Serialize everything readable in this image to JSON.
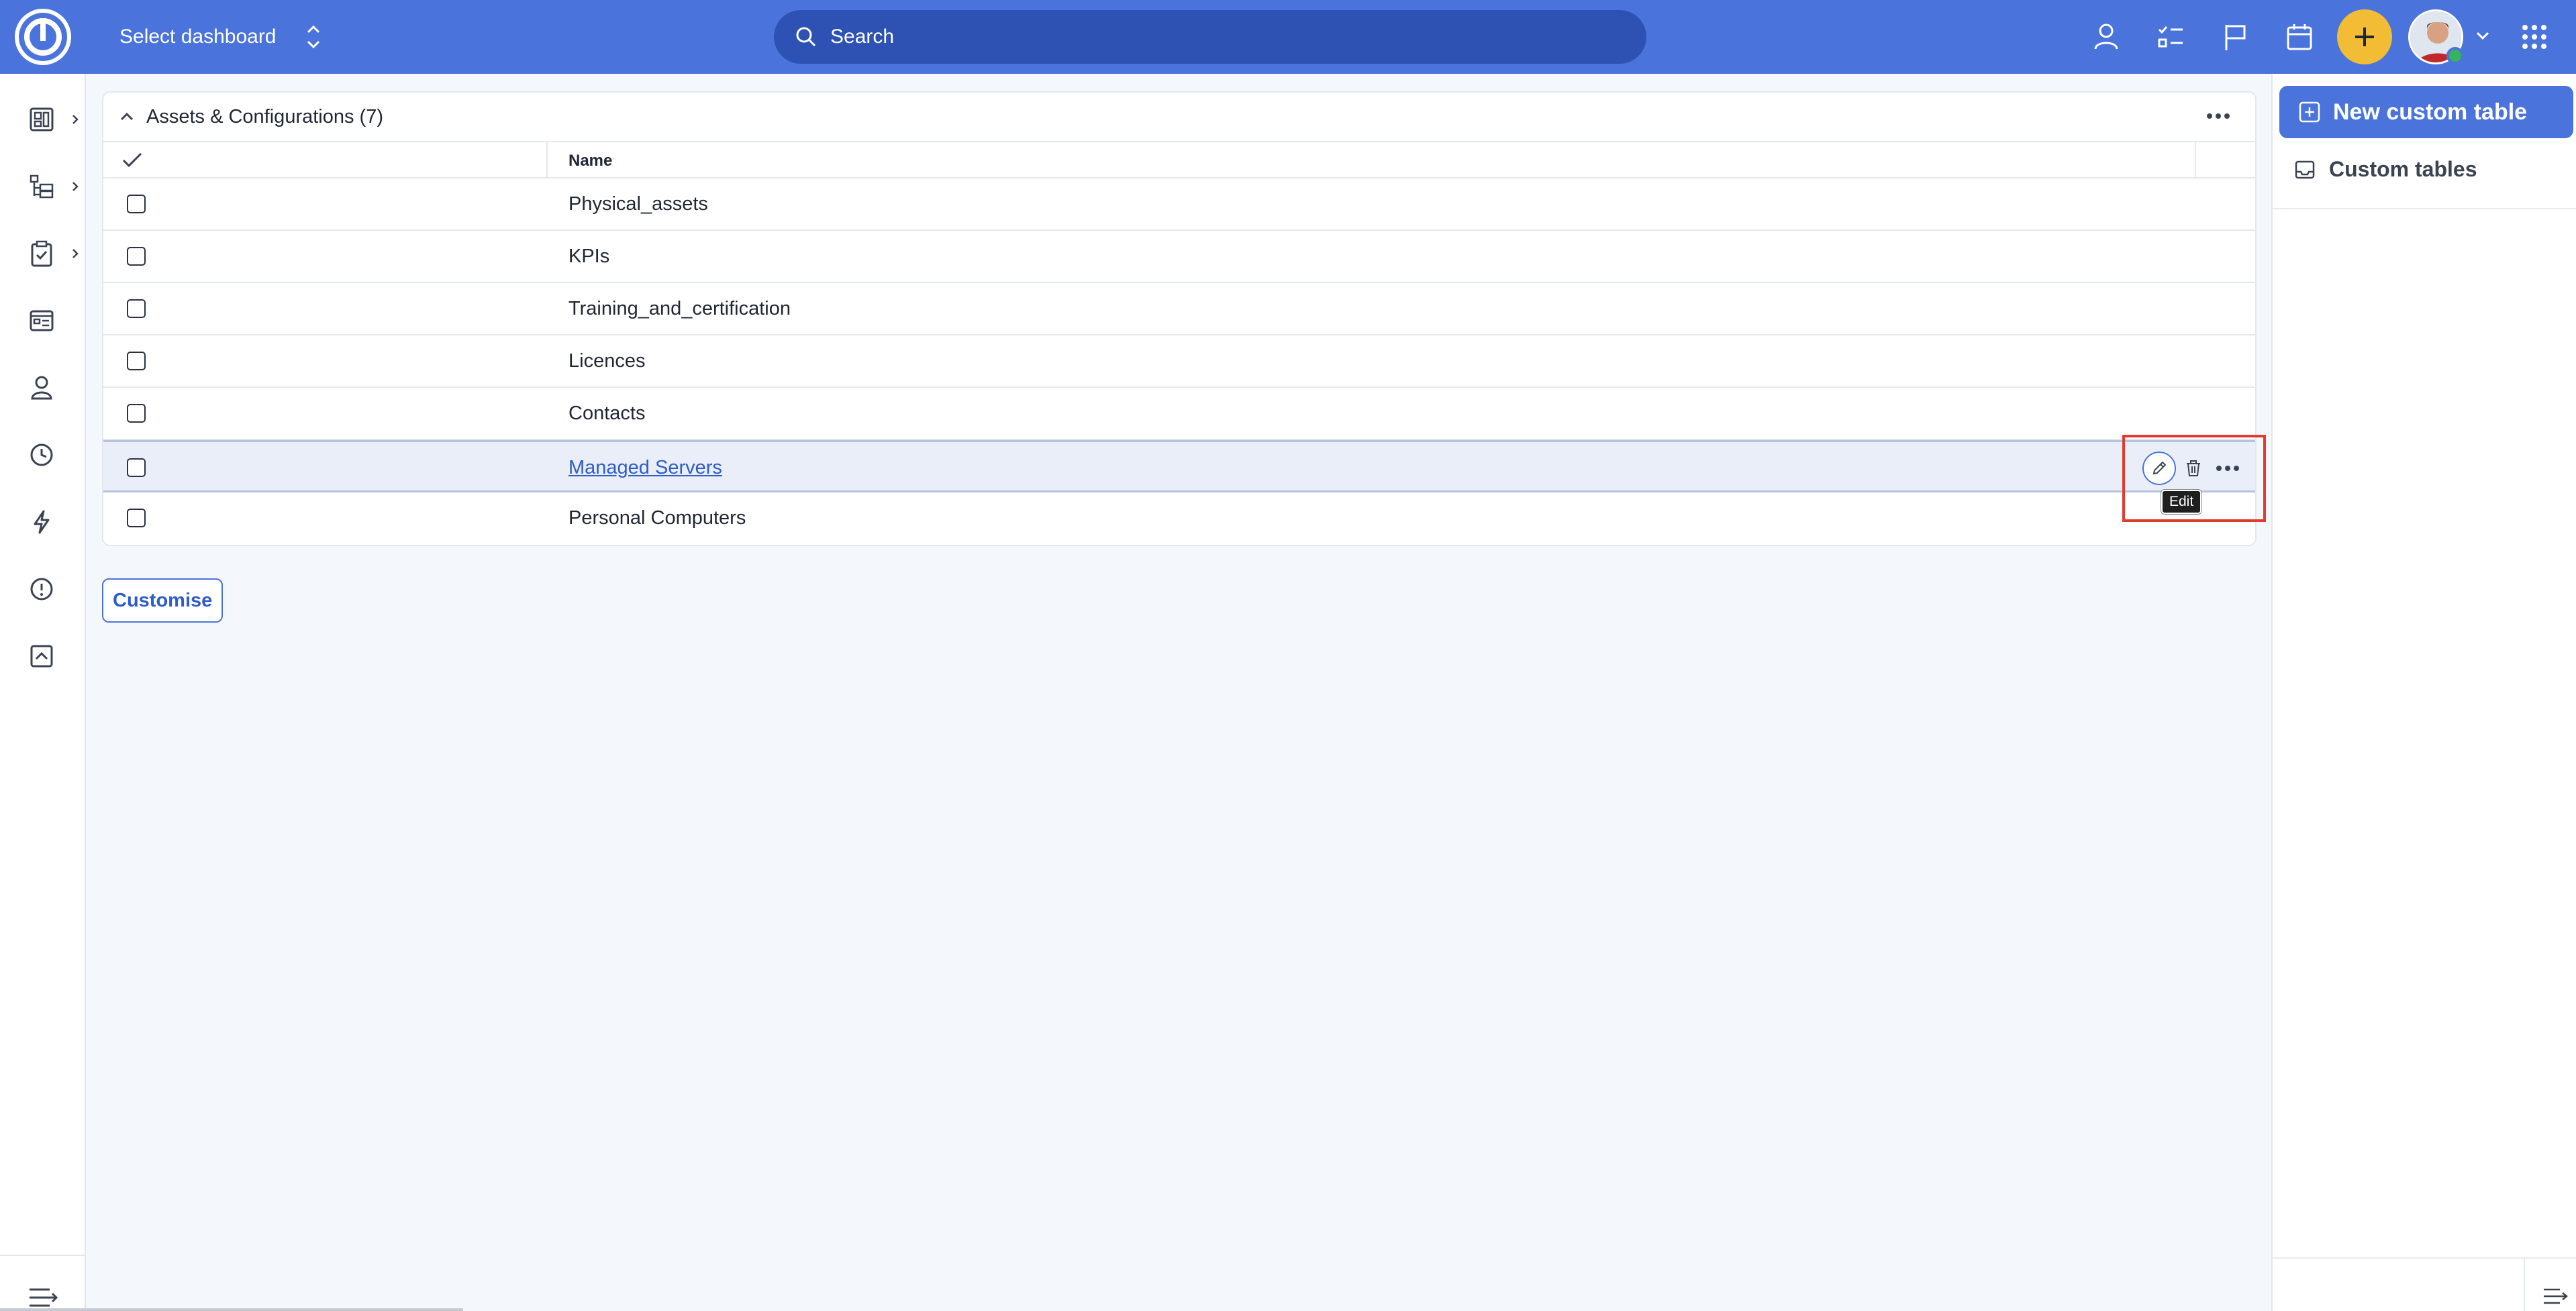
{
  "header": {
    "dashboard_label": "Select dashboard",
    "search_placeholder": "Search"
  },
  "panel": {
    "title": "Assets & Configurations (7)",
    "column_name": "Name",
    "rows": [
      {
        "name": "Physical_assets"
      },
      {
        "name": "KPIs"
      },
      {
        "name": "Training_and_certification"
      },
      {
        "name": "Licences"
      },
      {
        "name": "Contacts"
      },
      {
        "name": "Managed Servers"
      },
      {
        "name": "Personal Computers"
      }
    ],
    "tooltip": "Edit"
  },
  "customise_label": "Customise",
  "right_sidebar": {
    "new_button": "New custom table",
    "custom_tables_label": "Custom tables"
  },
  "colors": {
    "header_bg": "#4a74db",
    "search_bg": "#2e52b3",
    "plus_button": "#f2bd35",
    "highlight_border": "#e23b2e",
    "link": "#2e5cc9"
  }
}
